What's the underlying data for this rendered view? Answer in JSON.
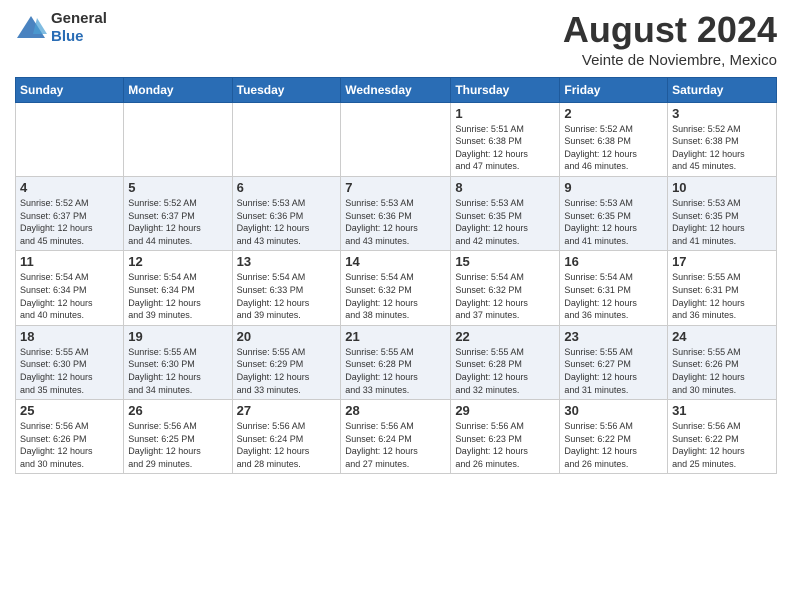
{
  "header": {
    "logo": {
      "general": "General",
      "blue": "Blue"
    },
    "title": "August 2024",
    "location": "Veinte de Noviembre, Mexico"
  },
  "weekdays": [
    "Sunday",
    "Monday",
    "Tuesday",
    "Wednesday",
    "Thursday",
    "Friday",
    "Saturday"
  ],
  "weeks": [
    [
      {
        "day": "",
        "info": ""
      },
      {
        "day": "",
        "info": ""
      },
      {
        "day": "",
        "info": ""
      },
      {
        "day": "",
        "info": ""
      },
      {
        "day": "1",
        "info": "Sunrise: 5:51 AM\nSunset: 6:38 PM\nDaylight: 12 hours\nand 47 minutes."
      },
      {
        "day": "2",
        "info": "Sunrise: 5:52 AM\nSunset: 6:38 PM\nDaylight: 12 hours\nand 46 minutes."
      },
      {
        "day": "3",
        "info": "Sunrise: 5:52 AM\nSunset: 6:38 PM\nDaylight: 12 hours\nand 45 minutes."
      }
    ],
    [
      {
        "day": "4",
        "info": "Sunrise: 5:52 AM\nSunset: 6:37 PM\nDaylight: 12 hours\nand 45 minutes."
      },
      {
        "day": "5",
        "info": "Sunrise: 5:52 AM\nSunset: 6:37 PM\nDaylight: 12 hours\nand 44 minutes."
      },
      {
        "day": "6",
        "info": "Sunrise: 5:53 AM\nSunset: 6:36 PM\nDaylight: 12 hours\nand 43 minutes."
      },
      {
        "day": "7",
        "info": "Sunrise: 5:53 AM\nSunset: 6:36 PM\nDaylight: 12 hours\nand 43 minutes."
      },
      {
        "day": "8",
        "info": "Sunrise: 5:53 AM\nSunset: 6:35 PM\nDaylight: 12 hours\nand 42 minutes."
      },
      {
        "day": "9",
        "info": "Sunrise: 5:53 AM\nSunset: 6:35 PM\nDaylight: 12 hours\nand 41 minutes."
      },
      {
        "day": "10",
        "info": "Sunrise: 5:53 AM\nSunset: 6:35 PM\nDaylight: 12 hours\nand 41 minutes."
      }
    ],
    [
      {
        "day": "11",
        "info": "Sunrise: 5:54 AM\nSunset: 6:34 PM\nDaylight: 12 hours\nand 40 minutes."
      },
      {
        "day": "12",
        "info": "Sunrise: 5:54 AM\nSunset: 6:34 PM\nDaylight: 12 hours\nand 39 minutes."
      },
      {
        "day": "13",
        "info": "Sunrise: 5:54 AM\nSunset: 6:33 PM\nDaylight: 12 hours\nand 39 minutes."
      },
      {
        "day": "14",
        "info": "Sunrise: 5:54 AM\nSunset: 6:32 PM\nDaylight: 12 hours\nand 38 minutes."
      },
      {
        "day": "15",
        "info": "Sunrise: 5:54 AM\nSunset: 6:32 PM\nDaylight: 12 hours\nand 37 minutes."
      },
      {
        "day": "16",
        "info": "Sunrise: 5:54 AM\nSunset: 6:31 PM\nDaylight: 12 hours\nand 36 minutes."
      },
      {
        "day": "17",
        "info": "Sunrise: 5:55 AM\nSunset: 6:31 PM\nDaylight: 12 hours\nand 36 minutes."
      }
    ],
    [
      {
        "day": "18",
        "info": "Sunrise: 5:55 AM\nSunset: 6:30 PM\nDaylight: 12 hours\nand 35 minutes."
      },
      {
        "day": "19",
        "info": "Sunrise: 5:55 AM\nSunset: 6:30 PM\nDaylight: 12 hours\nand 34 minutes."
      },
      {
        "day": "20",
        "info": "Sunrise: 5:55 AM\nSunset: 6:29 PM\nDaylight: 12 hours\nand 33 minutes."
      },
      {
        "day": "21",
        "info": "Sunrise: 5:55 AM\nSunset: 6:28 PM\nDaylight: 12 hours\nand 33 minutes."
      },
      {
        "day": "22",
        "info": "Sunrise: 5:55 AM\nSunset: 6:28 PM\nDaylight: 12 hours\nand 32 minutes."
      },
      {
        "day": "23",
        "info": "Sunrise: 5:55 AM\nSunset: 6:27 PM\nDaylight: 12 hours\nand 31 minutes."
      },
      {
        "day": "24",
        "info": "Sunrise: 5:55 AM\nSunset: 6:26 PM\nDaylight: 12 hours\nand 30 minutes."
      }
    ],
    [
      {
        "day": "25",
        "info": "Sunrise: 5:56 AM\nSunset: 6:26 PM\nDaylight: 12 hours\nand 30 minutes."
      },
      {
        "day": "26",
        "info": "Sunrise: 5:56 AM\nSunset: 6:25 PM\nDaylight: 12 hours\nand 29 minutes."
      },
      {
        "day": "27",
        "info": "Sunrise: 5:56 AM\nSunset: 6:24 PM\nDaylight: 12 hours\nand 28 minutes."
      },
      {
        "day": "28",
        "info": "Sunrise: 5:56 AM\nSunset: 6:24 PM\nDaylight: 12 hours\nand 27 minutes."
      },
      {
        "day": "29",
        "info": "Sunrise: 5:56 AM\nSunset: 6:23 PM\nDaylight: 12 hours\nand 26 minutes."
      },
      {
        "day": "30",
        "info": "Sunrise: 5:56 AM\nSunset: 6:22 PM\nDaylight: 12 hours\nand 26 minutes."
      },
      {
        "day": "31",
        "info": "Sunrise: 5:56 AM\nSunset: 6:22 PM\nDaylight: 12 hours\nand 25 minutes."
      }
    ]
  ]
}
